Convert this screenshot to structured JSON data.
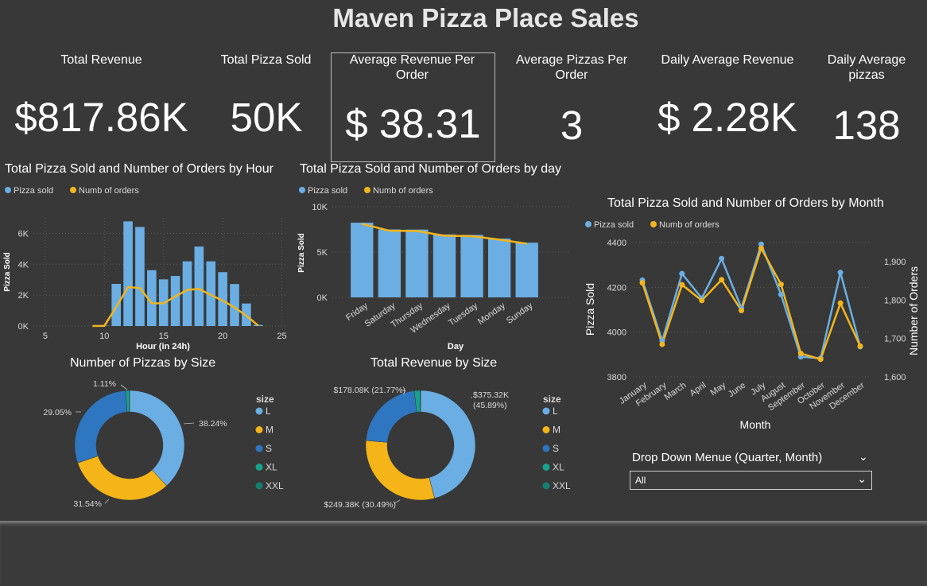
{
  "title": "Maven Pizza Place Sales",
  "kpis": [
    {
      "label": "Total Revenue",
      "value": "$817.86K"
    },
    {
      "label": "Total Pizza Sold",
      "value": "50K"
    },
    {
      "label": "Average Revenue Per Order",
      "value": "$ 38.31"
    },
    {
      "label": "Average Pizzas Per Order",
      "value": "3"
    },
    {
      "label": "Daily Average Revenue",
      "value": "$ 2.28K"
    },
    {
      "label": "Daily Average pizzas",
      "value": "138"
    }
  ],
  "colors": {
    "pizza_sold": "#6aaee3",
    "num_orders": "#f2b51d",
    "L": "#6aaee3",
    "M": "#f5b418",
    "S": "#2e76bf",
    "XL": "#17a28d",
    "XXL": "#137f6f"
  },
  "dropdown": {
    "label": "Drop Down Menue (Quarter, Month)",
    "value": "All"
  },
  "chart_data": [
    {
      "type": "bar",
      "title": "Total Pizza Sold and Number of Orders by Hour",
      "legend": [
        "Pizza sold",
        "Numb of orders"
      ],
      "xlabel": "Hour (in 24h)",
      "ylabel": "Pizza Sold",
      "xticks": [
        5,
        10,
        15,
        20,
        25
      ],
      "yticks": [
        "0K",
        "2K",
        "4K",
        "6K"
      ],
      "ylim": [
        0,
        7000
      ],
      "x": [
        9,
        10,
        11,
        12,
        13,
        14,
        15,
        16,
        17,
        18,
        19,
        20,
        21,
        22,
        23
      ],
      "series": [
        {
          "name": "Pizza sold",
          "values": [
            4,
            18,
            2728,
            6776,
            6413,
            3613,
            3020,
            3239,
            4186,
            5143,
            4185,
            3487,
            2718,
            1457,
            68
          ]
        },
        {
          "name": "Numb of orders",
          "values": [
            1,
            8,
            1231,
            2520,
            2455,
            1472,
            1468,
            1920,
            2336,
            2399,
            2009,
            1642,
            1198,
            663,
            28
          ]
        }
      ]
    },
    {
      "type": "bar",
      "title": "Total Pizza Sold and Number of Orders by day",
      "legend": [
        "Pizza sold",
        "Numb of orders"
      ],
      "xlabel": "Day",
      "ylabel": "Pizza Sold",
      "yticks": [
        "0K",
        "5K",
        "10K"
      ],
      "ylim": [
        0,
        10000
      ],
      "categories": [
        "Friday",
        "Saturday",
        "Thursday",
        "Wednesday",
        "Tuesday",
        "Monday",
        "Sunday"
      ],
      "series": [
        {
          "name": "Pizza sold",
          "values": [
            8242,
            7493,
            7478,
            6946,
            6895,
            6485,
            6035
          ]
        },
        {
          "name": "Numb of orders",
          "values": [
            8106,
            7355,
            7323,
            6797,
            6753,
            6369,
            5917
          ]
        }
      ]
    },
    {
      "type": "line",
      "title": "Total Pizza Sold and Number of Orders by Month",
      "legend": [
        "Pizza sold",
        "Numb of orders"
      ],
      "xlabel": "Month",
      "ylabel": "Pizza Sold",
      "ylabel_right": "Number of Orders",
      "yticks": [
        "3800",
        "4000",
        "4200",
        "4400"
      ],
      "yticks_right": [
        "1,600",
        "1,700",
        "1,800",
        "1,900"
      ],
      "ylim": [
        3800,
        4400
      ],
      "ylim_right": [
        1600,
        1950
      ],
      "categories": [
        "January",
        "February",
        "March",
        "April",
        "May",
        "June",
        "July",
        "August",
        "September",
        "October",
        "November",
        "December"
      ],
      "series": [
        {
          "name": "Pizza sold",
          "axis": "left",
          "values": [
            4232,
            3961,
            4261,
            4151,
            4328,
            4107,
            4392,
            4168,
            3890,
            3883,
            4266,
            3935
          ]
        },
        {
          "name": "Numb of orders",
          "axis": "right",
          "values": [
            1845,
            1685,
            1840,
            1799,
            1853,
            1773,
            1935,
            1841,
            1661,
            1646,
            1792,
            1680
          ]
        }
      ]
    },
    {
      "type": "pie",
      "title": "Number of Pizzas by Size",
      "legend_title": "size",
      "labels": [
        "L",
        "M",
        "S",
        "XL",
        "XXL"
      ],
      "values": [
        38.24,
        31.54,
        29.05,
        1.11,
        0.06
      ],
      "data_labels": [
        "38.24%",
        "31.54%",
        "29.05%",
        "1.11%",
        ""
      ]
    },
    {
      "type": "pie",
      "title": "Total Revenue by Size",
      "legend_title": "size",
      "labels": [
        "L",
        "M",
        "S",
        "XL",
        "XXL"
      ],
      "values": [
        375.32,
        249.38,
        178.08,
        14.08,
        1.01
      ],
      "data_labels": [
        "$375.32K (45.89%)",
        "$249.38K (30.49%)",
        "$178.08K (21.77%)",
        "",
        ""
      ]
    }
  ]
}
